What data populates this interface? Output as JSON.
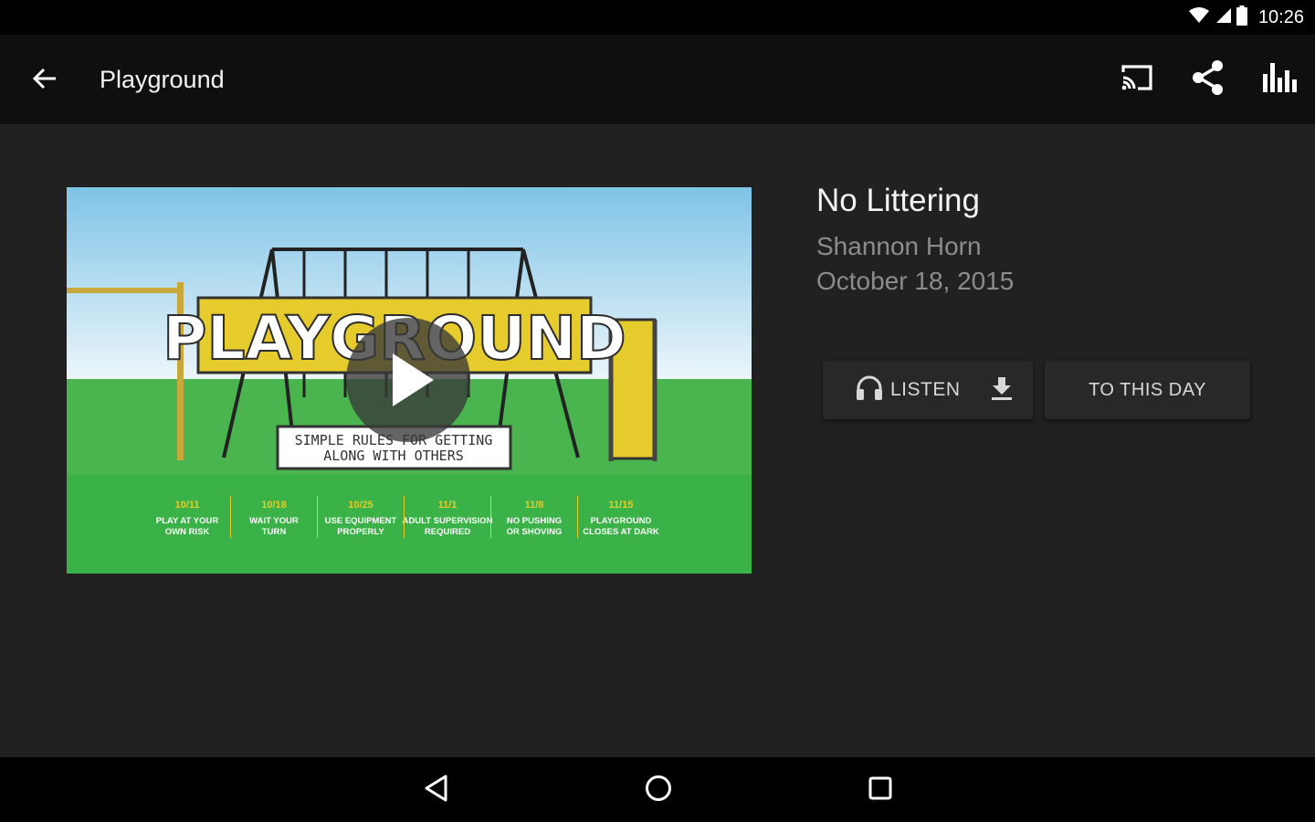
{
  "status_bar": {
    "time": "10:26",
    "icons": [
      "wifi-icon",
      "cell-signal-icon",
      "battery-icon"
    ]
  },
  "app_bar": {
    "title": "Playground",
    "back_icon": "arrow-back-icon",
    "actions": [
      "cast-icon",
      "share-icon",
      "equalizer-icon"
    ]
  },
  "episode": {
    "title": "No Littering",
    "speaker": "Shannon Horn",
    "date": "October 18, 2015",
    "artwork": {
      "banner": "PLAYGROUND",
      "tagline_1": "SIMPLE RULES FOR GETTING",
      "tagline_2": "ALONG WITH OTHERS",
      "schedule": [
        {
          "date": "10/11",
          "line1": "PLAY AT YOUR",
          "line2": "OWN RISK"
        },
        {
          "date": "10/18",
          "line1": "WAIT YOUR",
          "line2": "TURN"
        },
        {
          "date": "10/25",
          "line1": "USE EQUIPMENT",
          "line2": "PROPERLY"
        },
        {
          "date": "11/1",
          "line1": "ADULT SUPERVISION",
          "line2": "REQUIRED"
        },
        {
          "date": "11/8",
          "line1": "NO PUSHING",
          "line2": "OR SHOVING"
        },
        {
          "date": "11/15",
          "line1": "PLAYGROUND",
          "line2": "CLOSES AT DARK"
        }
      ]
    }
  },
  "buttons": {
    "listen": "LISTEN",
    "to_this_day": "TO THIS DAY"
  },
  "nav_bar": [
    "back-triangle-icon",
    "home-circle-icon",
    "recents-square-icon"
  ],
  "colors": {
    "background": "#212121",
    "appbar": "#0f0f0f",
    "banner_yellow": "#e5cc2a",
    "grass": "#3fb84a",
    "sky": "#8fcbe9"
  }
}
